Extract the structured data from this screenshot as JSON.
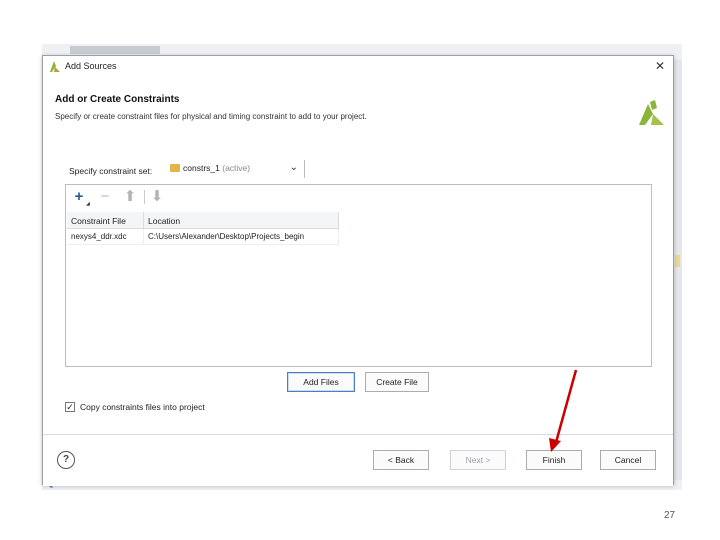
{
  "dialog": {
    "title": "Add Sources",
    "close_label": "✕",
    "header_title": "Add or Create Constraints",
    "header_subtitle": "Specify or create constraint files for physical and timing constraint to add to your project."
  },
  "constraint_set": {
    "label": "Specify constraint set:",
    "value": "constrs_1",
    "value_suffix": "(active)"
  },
  "toolbar": {
    "add_icon": "plus-icon",
    "remove_icon": "minus-icon",
    "up_icon": "arrow-up-icon",
    "down_icon": "arrow-down-icon"
  },
  "table": {
    "columns": [
      "Constraint File",
      "Location"
    ],
    "rows": [
      [
        "nexys4_ddr.xdc",
        "C:\\Users\\Alexander\\Desktop\\Projects_begin"
      ]
    ]
  },
  "buttons": {
    "add_files": "Add Files",
    "create_file": "Create File"
  },
  "copy_option": {
    "label": "Copy constraints files into project",
    "checked": true,
    "check_mark": "✓"
  },
  "footer": {
    "help": "?",
    "back": "< Back",
    "next": "Next >",
    "finish": "Finish",
    "cancel": "Cancel"
  },
  "annotation": {
    "arrow_color": "#cc0000"
  },
  "page_number": "27",
  "colors": {
    "accent_blue": "#4a7fc0",
    "logo_green": "#8ab43a",
    "folder": "#e0b64a"
  }
}
